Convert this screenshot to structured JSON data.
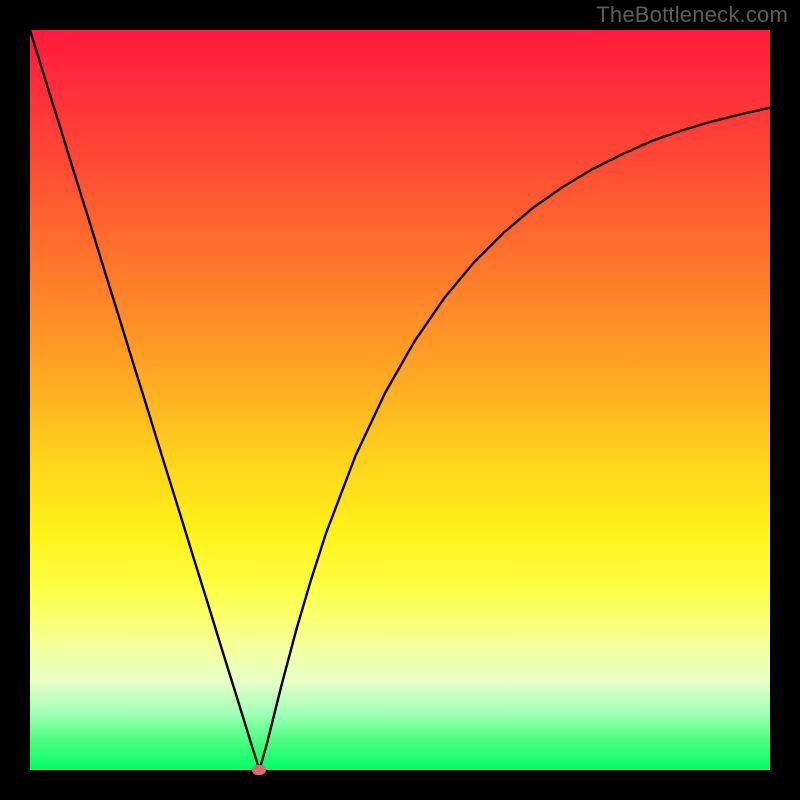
{
  "watermark": "TheBottleneck.com",
  "colors": {
    "background": "#000000",
    "curve": "#000000",
    "marker": "#d86b6f",
    "gradient_top": "#ff1a3d",
    "gradient_bottom": "#00ff66"
  },
  "chart_data": {
    "type": "line",
    "title": "",
    "xlabel": "",
    "ylabel": "",
    "xlim": [
      0,
      100
    ],
    "ylim": [
      0,
      100
    ],
    "x": [
      0,
      2,
      4,
      6,
      8,
      10,
      12,
      14,
      16,
      18,
      20,
      22,
      24,
      26,
      28,
      30,
      31,
      32,
      34,
      36,
      38,
      40,
      44,
      48,
      52,
      56,
      60,
      64,
      68,
      72,
      76,
      80,
      84,
      88,
      92,
      96,
      100
    ],
    "values": [
      100,
      93.5,
      87.1,
      80.6,
      74.2,
      67.7,
      61.3,
      54.8,
      48.4,
      41.9,
      35.5,
      29.0,
      22.6,
      16.1,
      9.7,
      3.2,
      0,
      3.5,
      11.5,
      19.0,
      25.8,
      32.0,
      42.5,
      51.0,
      58.0,
      63.8,
      68.6,
      72.6,
      76.0,
      78.8,
      81.2,
      83.2,
      85.0,
      86.4,
      87.6,
      88.6,
      89.5
    ],
    "marker": {
      "x": 31,
      "y": 0
    },
    "annotations": []
  }
}
